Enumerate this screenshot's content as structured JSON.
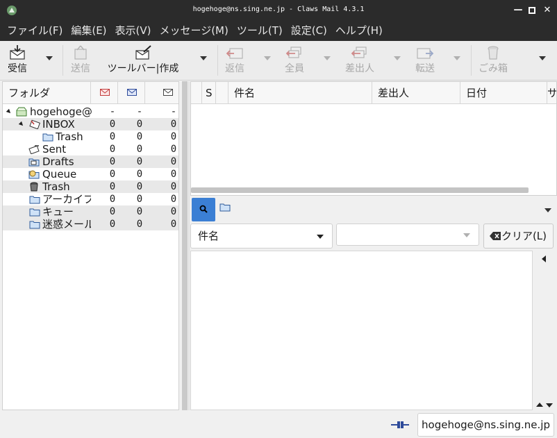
{
  "window": {
    "title": "hogehoge@ns.sing.ne.jp - Claws Mail 4.3.1",
    "icons": {
      "app": "claws-mail-icon",
      "minimize": "minimize-icon",
      "maximize": "maximize-icon",
      "close": "close-icon"
    }
  },
  "menubar": {
    "items": [
      "ファイル(F)",
      "編集(E)",
      "表示(V)",
      "メッセージ(M)",
      "ツール(T)",
      "設定(C)",
      "ヘルプ(H)"
    ]
  },
  "toolbar": {
    "receive": "受信",
    "send": "送信",
    "compose": "ツールバー|作成",
    "reply": "返信",
    "reply_all": "全員",
    "reply_sender": "差出人",
    "forward": "転送",
    "trash": "ごみ箱"
  },
  "folders": {
    "header": {
      "name": "フォルダ",
      "icons": [
        "unread-mail-icon",
        "new-mail-icon",
        "total-mail-icon"
      ]
    },
    "rows": [
      {
        "name": "hogehoge@",
        "unread": "-",
        "new": "-",
        "total": "-",
        "icon": "mailbox-icon"
      },
      {
        "name": "INBOX",
        "unread": "0",
        "new": "0",
        "total": "0",
        "icon": "inbox-icon"
      },
      {
        "name": "Trash",
        "unread": "0",
        "new": "0",
        "total": "0",
        "icon": "folder-icon"
      },
      {
        "name": "Sent",
        "unread": "0",
        "new": "0",
        "total": "0",
        "icon": "sent-icon"
      },
      {
        "name": "Drafts",
        "unread": "0",
        "new": "0",
        "total": "0",
        "icon": "drafts-icon"
      },
      {
        "name": "Queue",
        "unread": "0",
        "new": "0",
        "total": "0",
        "icon": "queue-icon"
      },
      {
        "name": "Trash",
        "unread": "0",
        "new": "0",
        "total": "0",
        "icon": "trash-icon"
      },
      {
        "name": "アーカイブ",
        "unread": "0",
        "new": "0",
        "total": "0",
        "icon": "folder-icon"
      },
      {
        "name": "キュー",
        "unread": "0",
        "new": "0",
        "total": "0",
        "icon": "folder-icon"
      },
      {
        "name": "迷惑メール",
        "unread": "0",
        "new": "0",
        "total": "0",
        "icon": "folder-icon"
      }
    ]
  },
  "messages": {
    "columns": [
      "",
      "S",
      "",
      "件名",
      "差出人",
      "日付",
      "サ"
    ]
  },
  "quicksearch": {
    "type_label": "件名",
    "input_value": "",
    "clear_label": "クリア(L)"
  },
  "statusbar": {
    "account": "hogehoge@ns.sing.ne.jp"
  },
  "colors": {
    "accent": "#3b7fd4",
    "titlebar": "#2b2b2b"
  }
}
